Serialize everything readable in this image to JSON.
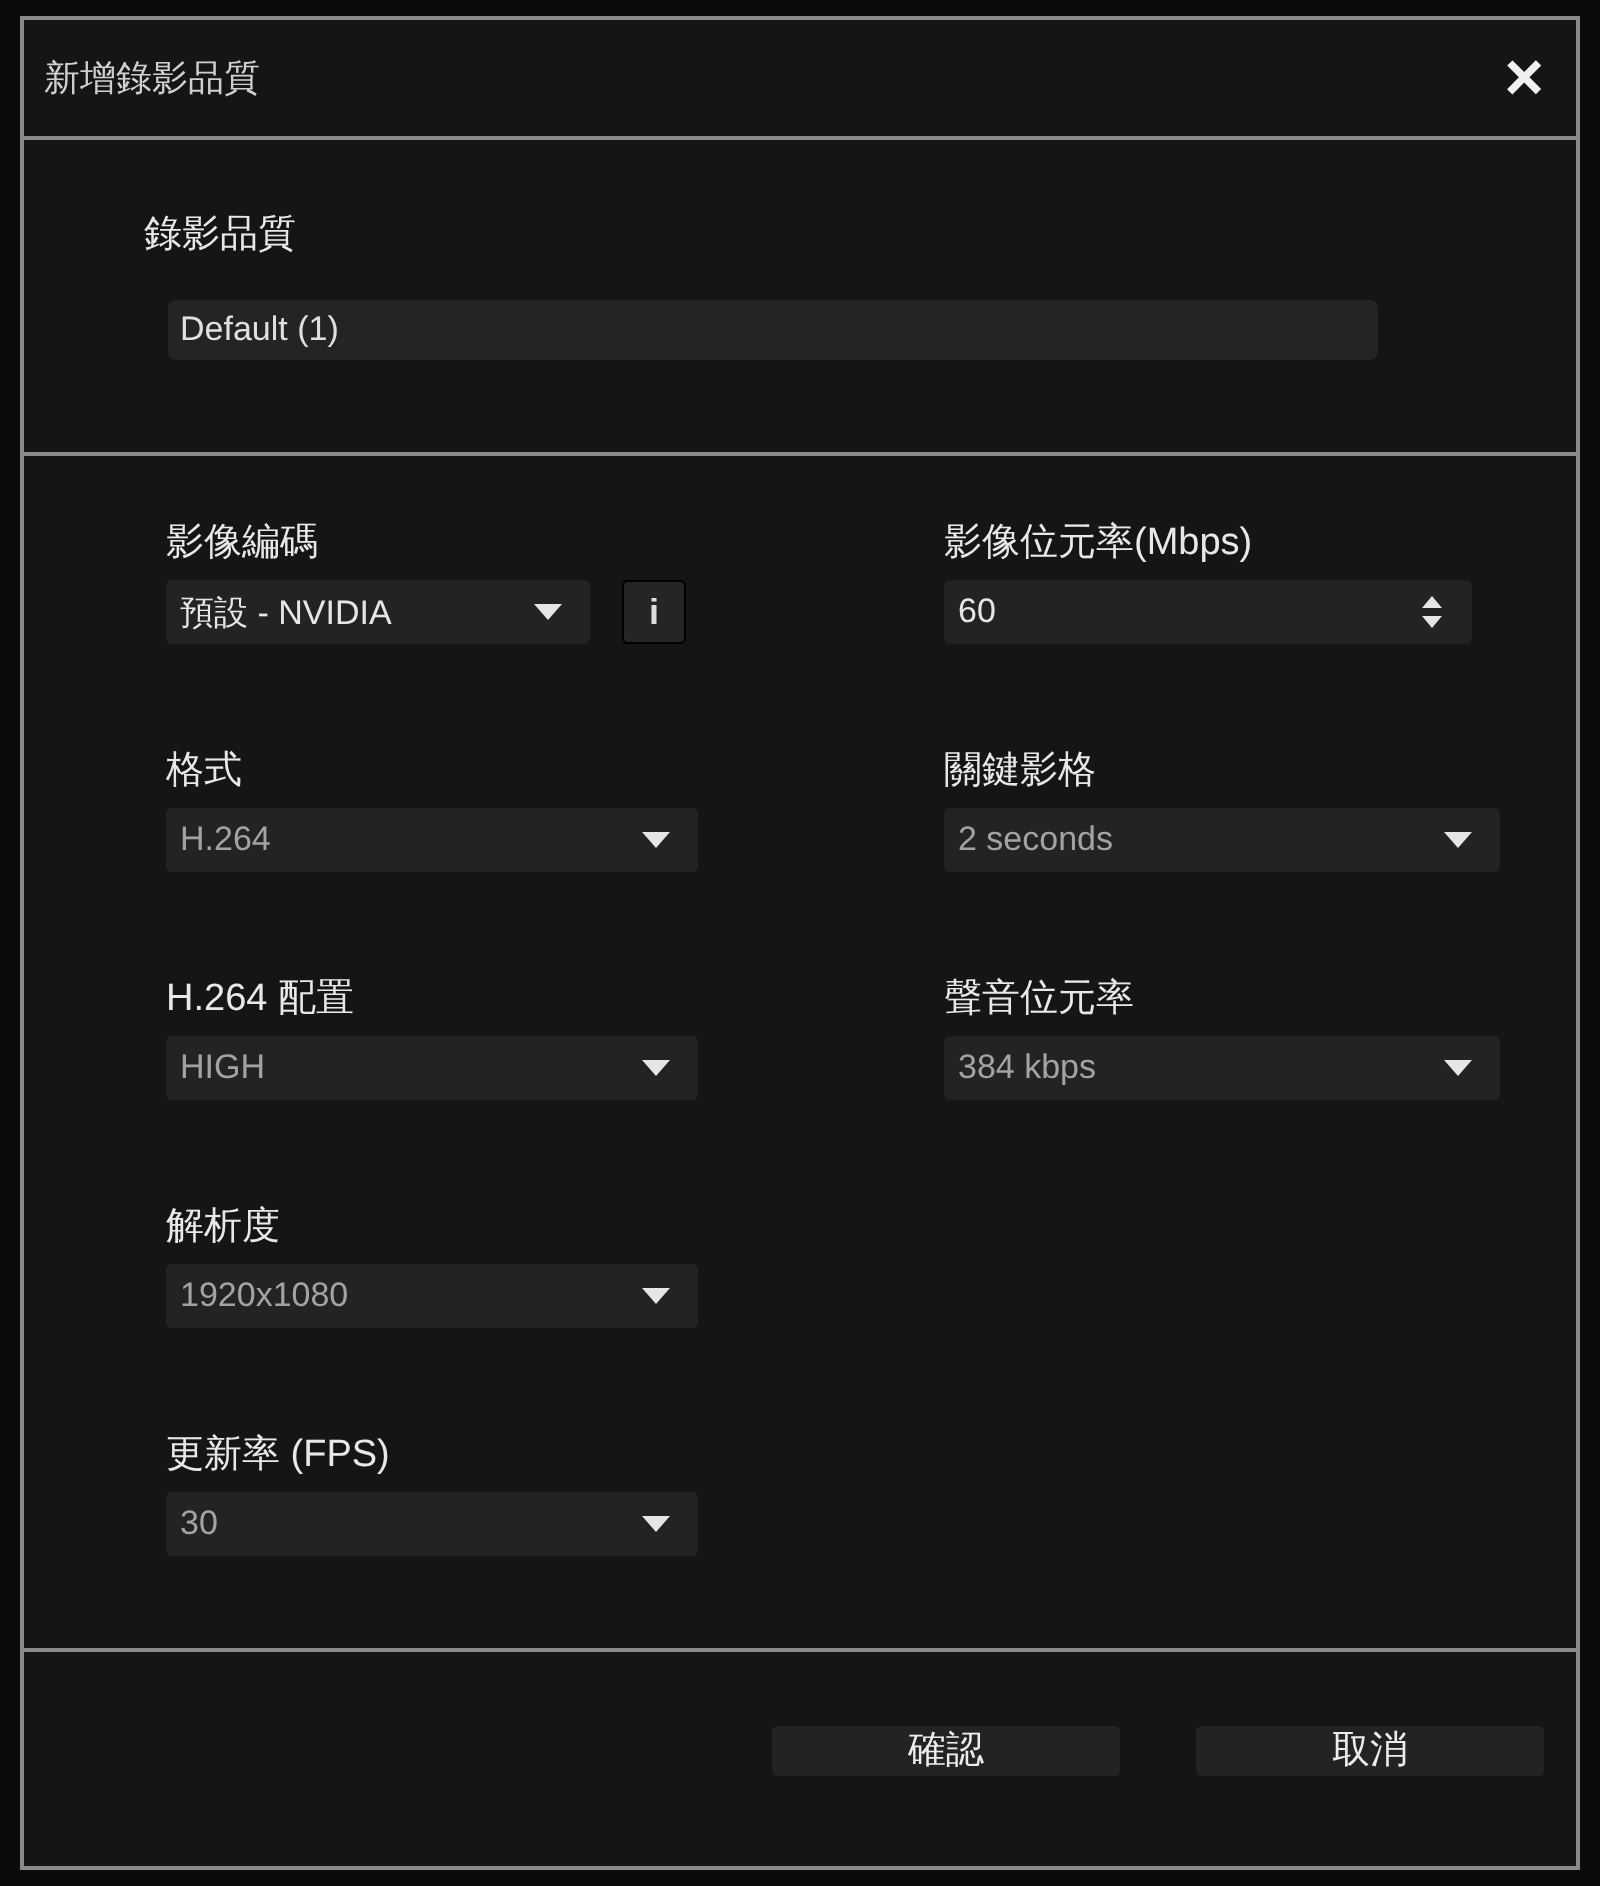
{
  "window": {
    "title": "新增錄影品質",
    "close": "×"
  },
  "name_section": {
    "label": "錄影品質",
    "value": "Default (1)"
  },
  "left_fields": [
    {
      "label": "影像編碼",
      "kind": "dropdown",
      "value": "預設 - NVIDIA",
      "disabled": false,
      "info_button": "i"
    },
    {
      "label": "格式",
      "kind": "dropdown",
      "value": "H.264",
      "disabled": true
    },
    {
      "label": "H.264 配置",
      "kind": "dropdown",
      "value": "HIGH",
      "disabled": true
    },
    {
      "label": "解析度",
      "kind": "dropdown",
      "value": "1920x1080",
      "disabled": true
    },
    {
      "label": "更新率 (FPS)",
      "kind": "dropdown",
      "value": "30",
      "disabled": true
    }
  ],
  "right_fields": [
    {
      "label": "影像位元率(Mbps)",
      "kind": "spinner",
      "value": "60",
      "disabled": false
    },
    {
      "label": "關鍵影格",
      "kind": "dropdown",
      "value": "2 seconds",
      "disabled": true
    },
    {
      "label": "聲音位元率",
      "kind": "dropdown",
      "value": "384 kbps",
      "disabled": true
    }
  ],
  "buttons": [
    "確認",
    "取消"
  ]
}
